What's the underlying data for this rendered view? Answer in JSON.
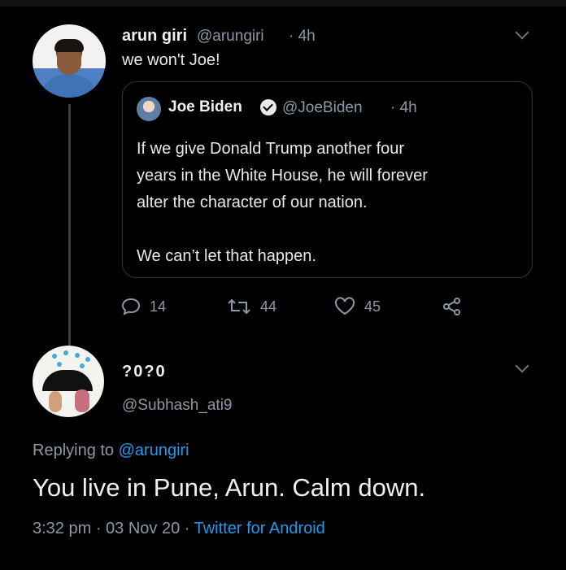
{
  "tweet1": {
    "name": "arun giri",
    "handle": "@arungiri",
    "time": "· 4h",
    "text": "we won't Joe!",
    "quote": {
      "name": "Joe Biden",
      "handle": "@JoeBiden",
      "time": "· 4h",
      "lines": [
        "If we give Donald Trump another four",
        "years in the White House, he will forever",
        "alter the character of our nation.",
        "We can’t let that happen."
      ]
    },
    "actions": {
      "replies": "14",
      "retweets": "44",
      "likes": "45"
    }
  },
  "tweet2": {
    "name": "?0?0",
    "handle": "@Subhash_ati9",
    "replying_prefix": "Replying to ",
    "replying_to": "@arungiri",
    "text": "You live in Pune, Arun. Calm down.",
    "timestamp": "3:32 pm · 03 Nov 20 · ",
    "source": "Twitter for Android"
  },
  "icons": [
    "chevron-down-icon",
    "verified-icon",
    "reply-icon",
    "retweet-icon",
    "like-icon",
    "share-icon"
  ],
  "colors": {
    "link": "#1d9bf0",
    "muted": "#8b98a5",
    "background": "#000000"
  }
}
